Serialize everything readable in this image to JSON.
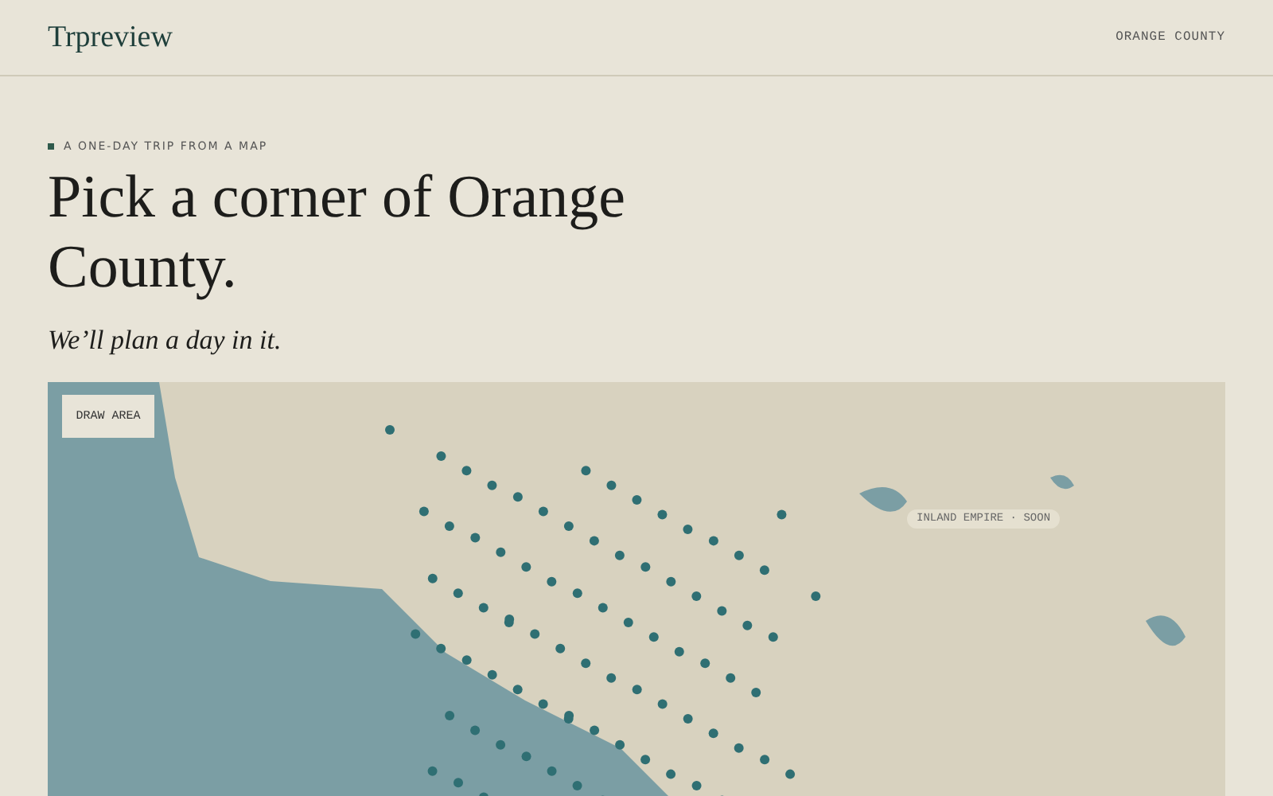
{
  "header": {
    "logo": "Trpreview",
    "region": "ORANGE COUNTY"
  },
  "hero": {
    "eyebrow": "A ONE-DAY TRIP FROM A MAP",
    "title": "Pick a corner of Orange County.",
    "subtitle": "We’ll plan a day in it."
  },
  "map": {
    "draw_button": "DRAW AREA",
    "region_label": "INLAND EMPIRE · SOON"
  }
}
